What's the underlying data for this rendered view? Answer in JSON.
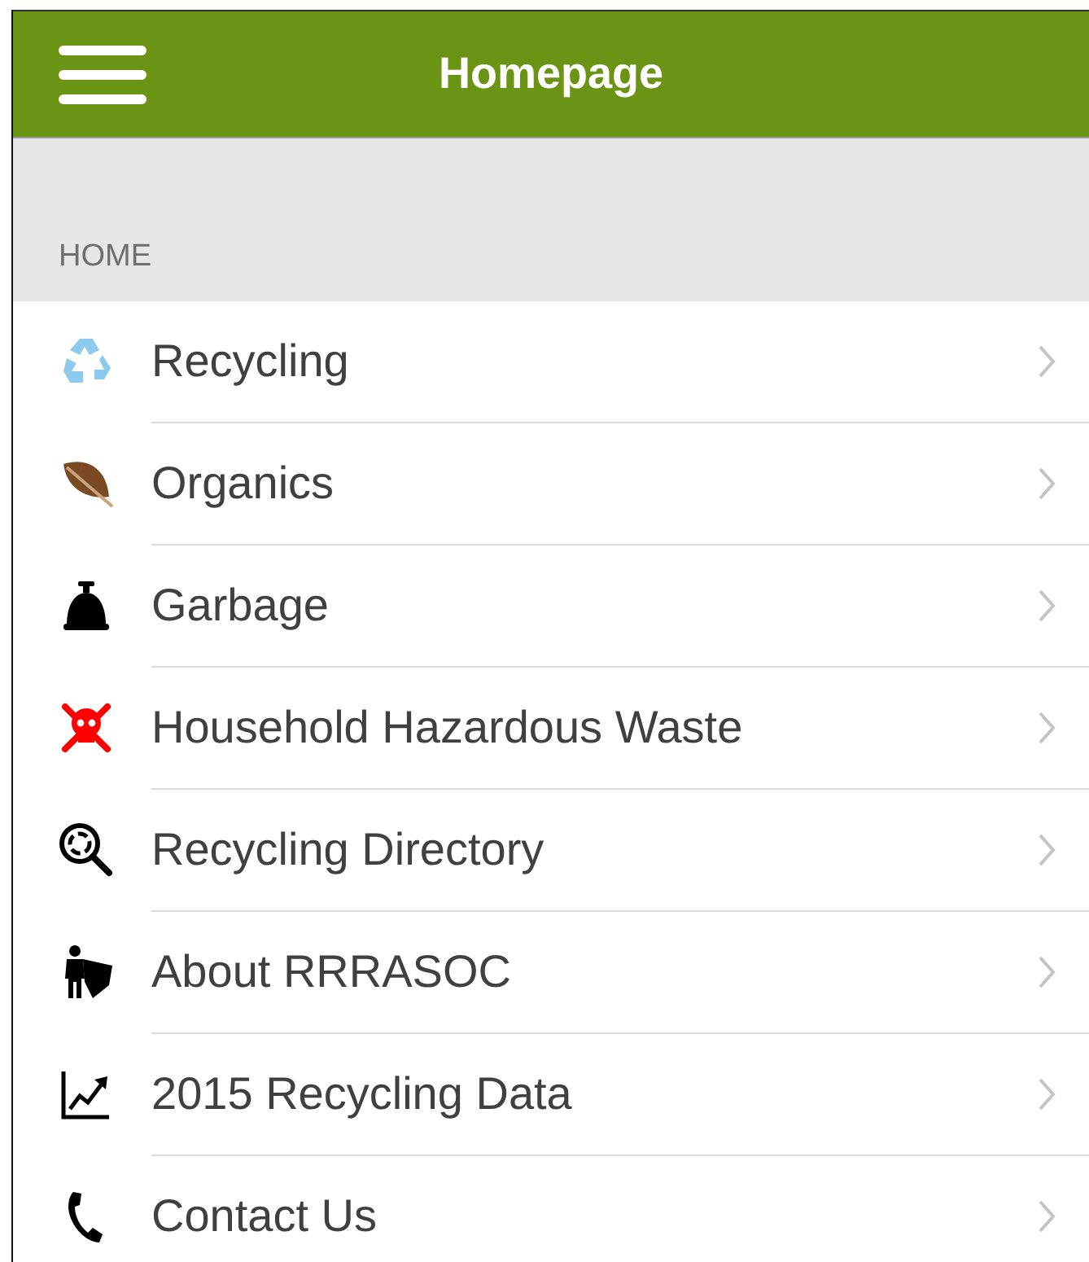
{
  "header": {
    "title": "Homepage"
  },
  "section": {
    "label": "HOME"
  },
  "items": [
    {
      "label": "Recycling"
    },
    {
      "label": "Organics"
    },
    {
      "label": "Garbage"
    },
    {
      "label": "Household Hazardous Waste"
    },
    {
      "label": "Recycling Directory"
    },
    {
      "label": "About RRRASOC"
    },
    {
      "label": "2015 Recycling Data"
    },
    {
      "label": "Contact Us"
    }
  ]
}
